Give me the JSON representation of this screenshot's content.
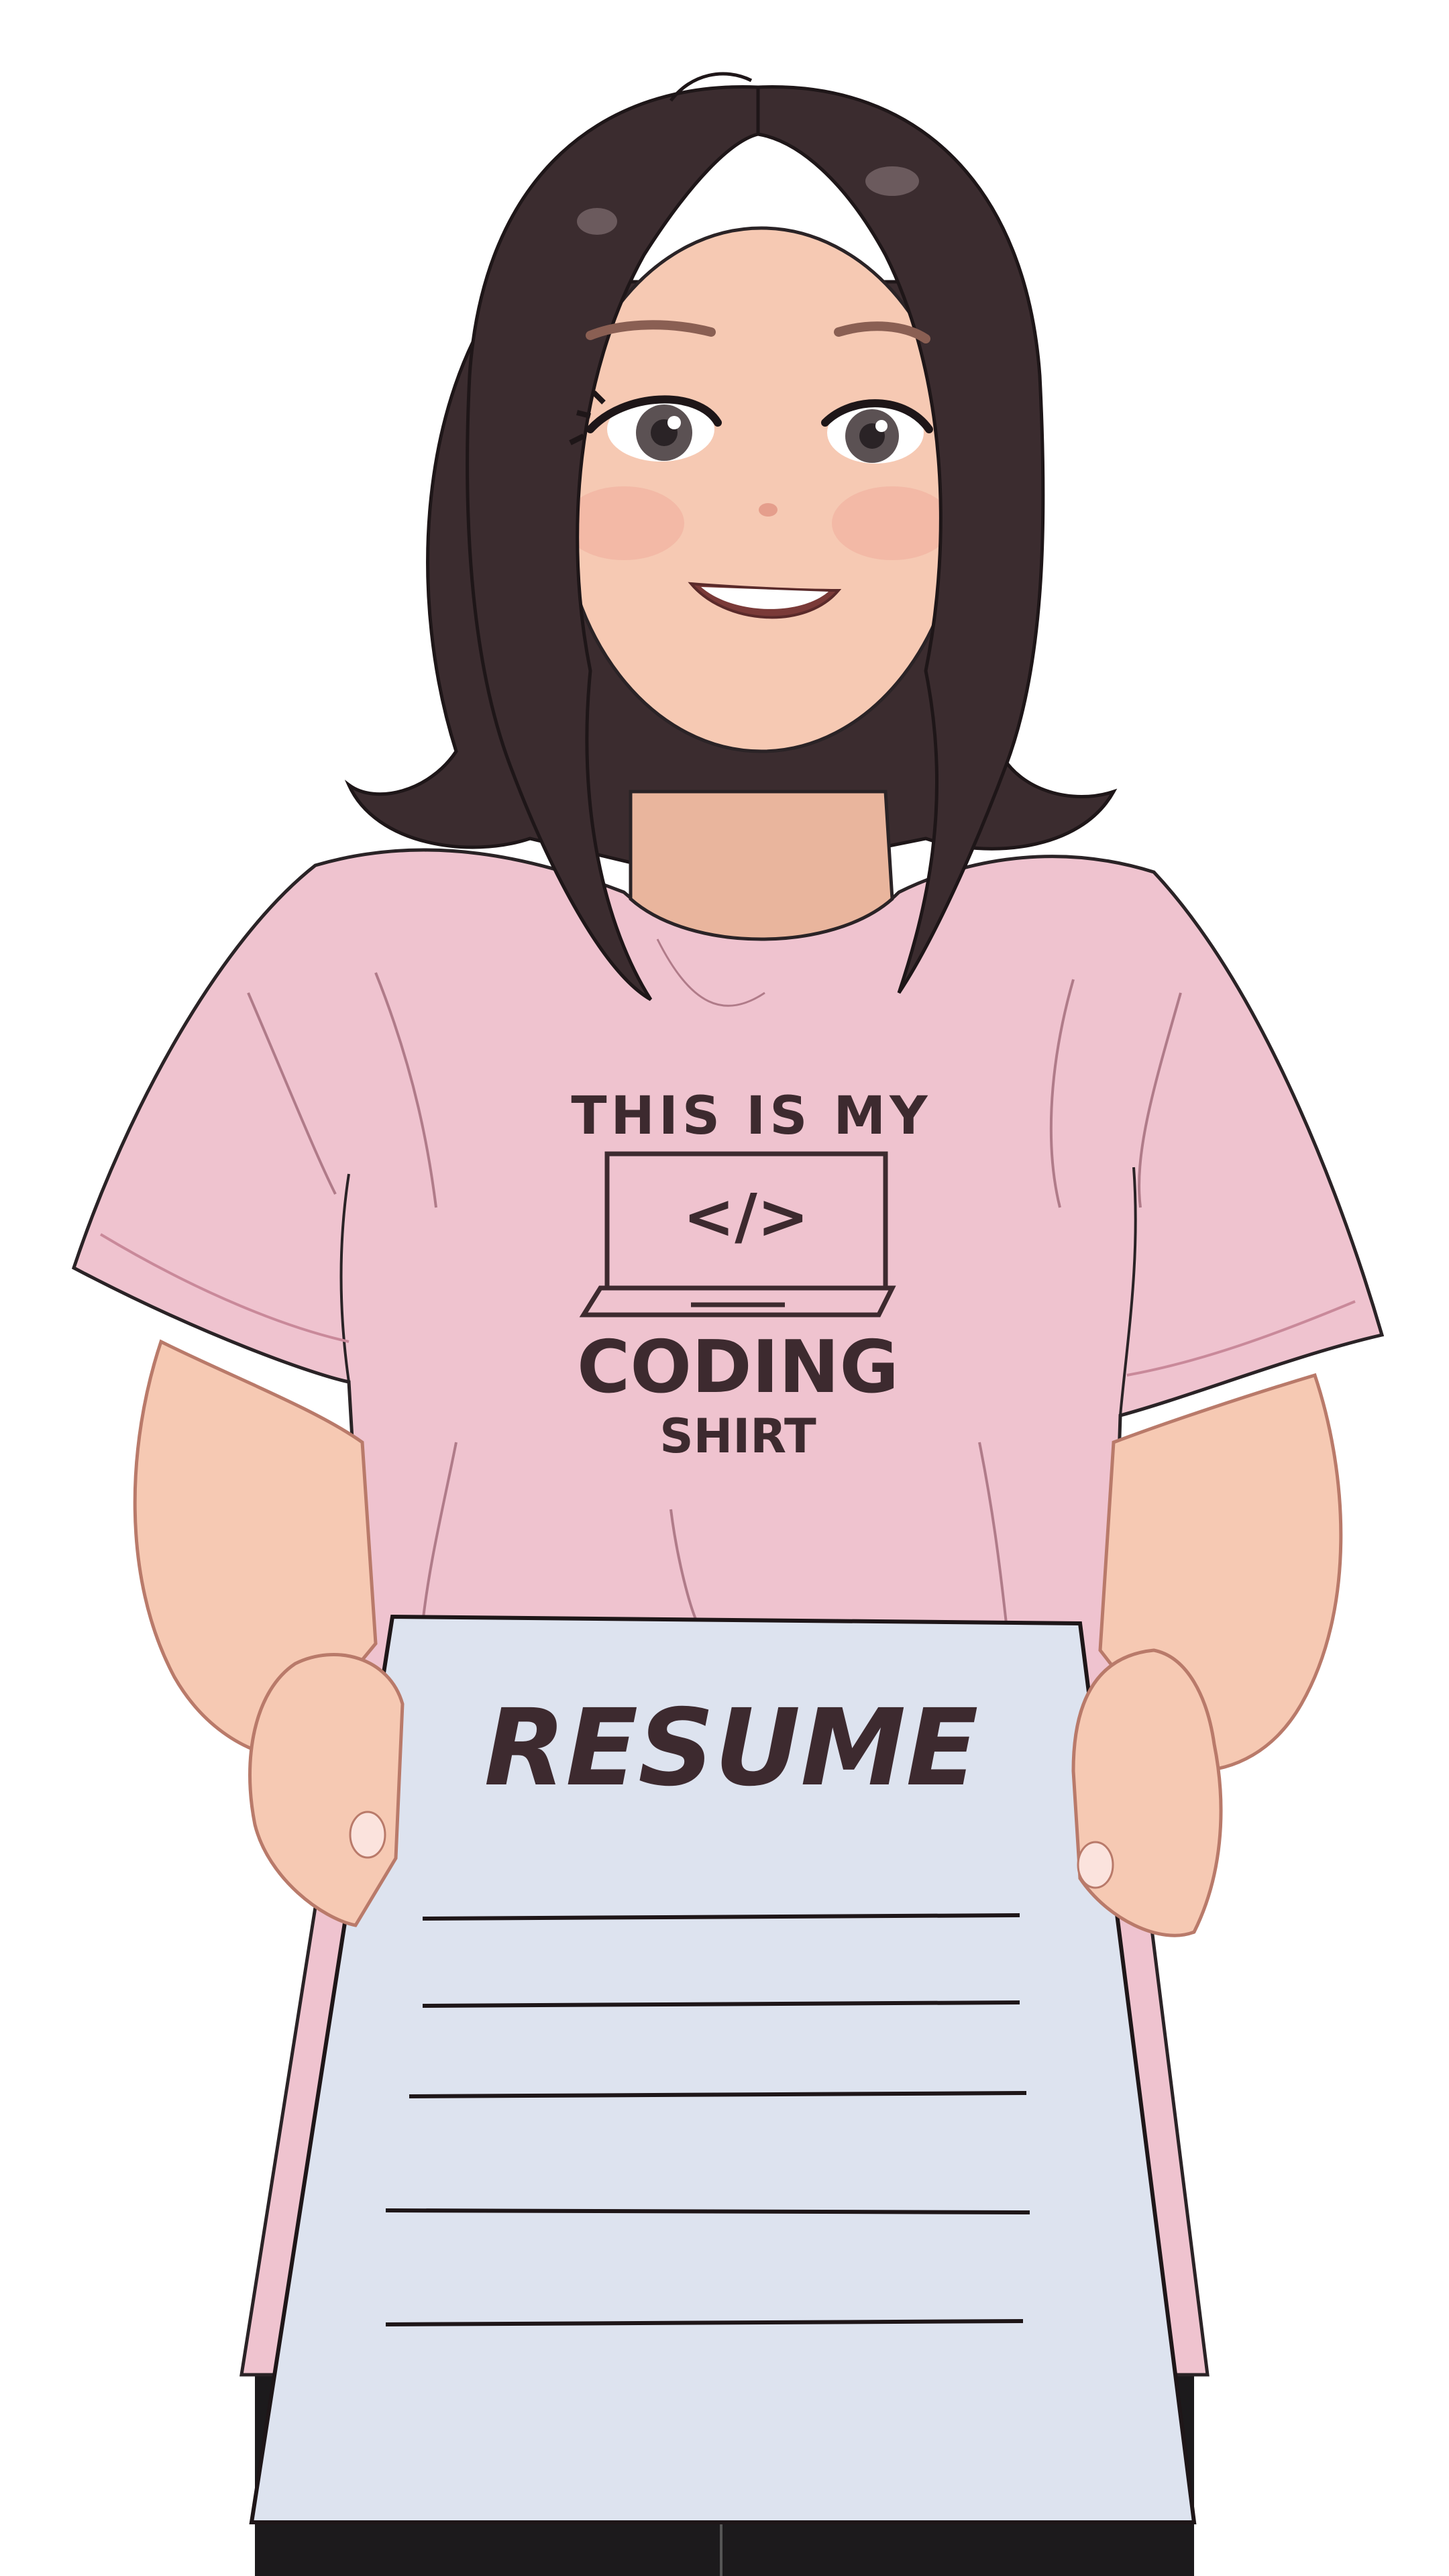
{
  "shirt": {
    "line1": "THIS IS MY",
    "code_glyph": "</>",
    "line2": "CODING",
    "line3": "SHIRT"
  },
  "paper": {
    "title": "RESUME",
    "blank_lines": 5
  },
  "colors": {
    "background": "#ffffff",
    "hair": "#3b2c2f",
    "skin": "#f6c9b3",
    "shirt": "#efc3cf",
    "paper": "#dde3ef",
    "ink": "#3d2a2f",
    "pants": "#1c1a1c"
  }
}
